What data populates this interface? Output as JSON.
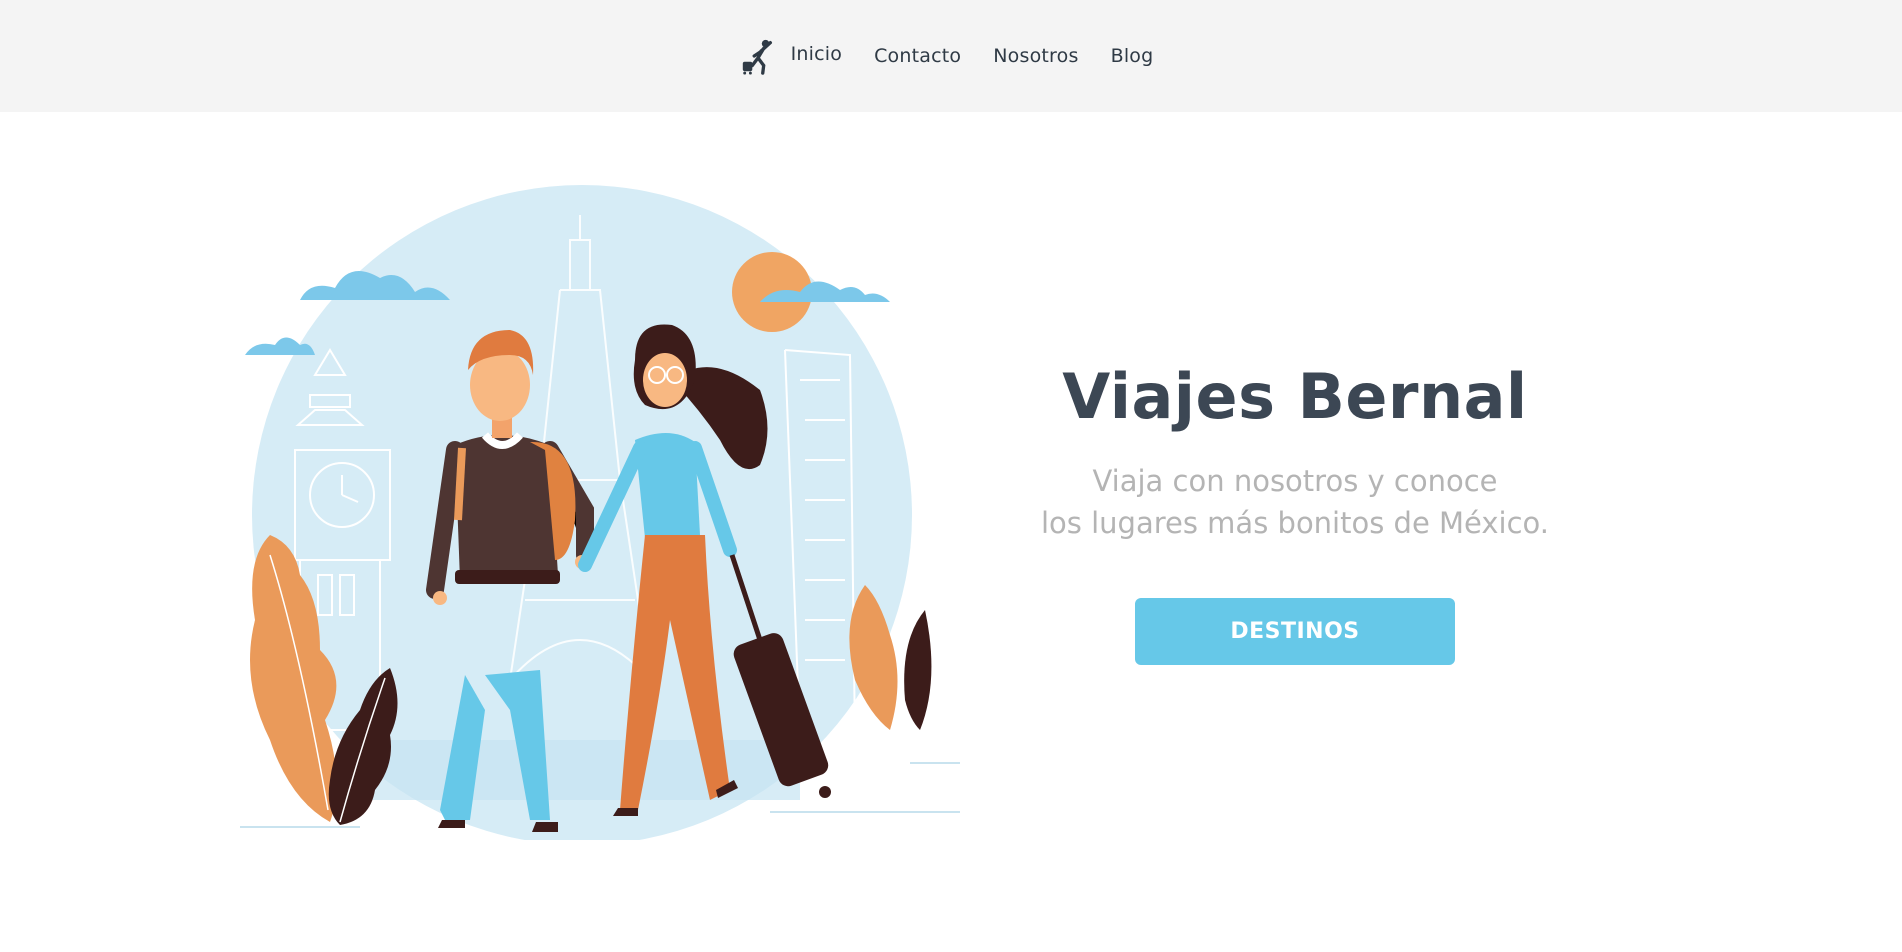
{
  "nav": {
    "logo_icon": "running-traveler-icon",
    "links": [
      "Inicio",
      "Contacto",
      "Nosotros",
      "Blog"
    ]
  },
  "hero": {
    "title": "Viajes Bernal",
    "subtitle_line1": "Viaja con nosotros y conoce",
    "subtitle_line2": "los lugares más bonitos de México.",
    "button_label": "DESTINOS",
    "illustration_icon": "travel-couple-illustration"
  },
  "colors": {
    "nav_bg": "#f4f4f4",
    "accent": "#66c8e8",
    "title": "#3c4754",
    "subtitle": "#b4b4b4"
  }
}
